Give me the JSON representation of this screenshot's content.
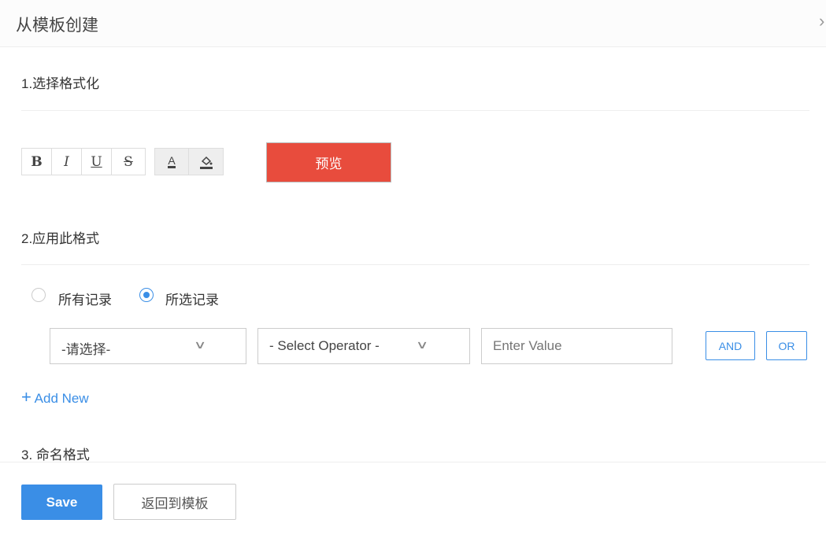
{
  "header": {
    "title": "从模板创建",
    "close": "›"
  },
  "sections": {
    "s1": "1.选择格式化",
    "s2": "2.应用此格式",
    "s3": "3. 命名格式"
  },
  "format": {
    "bold": "B",
    "italic": "I",
    "underline": "U",
    "strike": "S",
    "font_color": "A",
    "preview": "预览"
  },
  "apply": {
    "all": "所有记录",
    "selected": "所选记录",
    "selected_option": "selected"
  },
  "criteria": {
    "field": "-请选择-",
    "operator": "- Select Operator -",
    "value_placeholder": "Enter Value",
    "and": "AND",
    "or": "OR",
    "add_new": "Add New"
  },
  "footer": {
    "save": "Save",
    "back": "返回到模板"
  },
  "colors": {
    "accent": "#3a8ee6",
    "preview": "#e84c3d"
  }
}
